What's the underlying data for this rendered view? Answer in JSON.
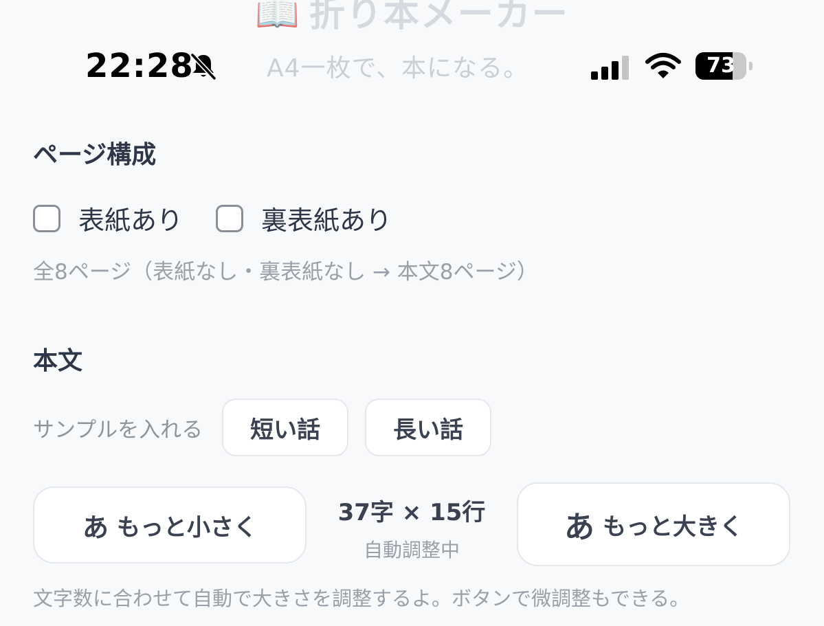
{
  "app": {
    "title_icon": "📖",
    "title": "折り本メーカー",
    "subtitle": "A4一枚で、本になる。"
  },
  "status_bar": {
    "time": "22:28",
    "mute_icon": "bell-slash-icon",
    "signal_icon": "cellular-signal-icon",
    "wifi_icon": "wifi-icon",
    "battery_level": "73",
    "battery_percent": 73
  },
  "page_structure": {
    "heading": "ページ構成",
    "front_cover": {
      "label": "表紙あり",
      "checked": false
    },
    "back_cover": {
      "label": "裏表紙あり",
      "checked": false
    },
    "summary": "全8ページ（表紙なし・裏表紙なし → 本文8ページ）"
  },
  "body_text": {
    "heading": "本文",
    "sample_label": "サンプルを入れる",
    "short_story_button": "短い話",
    "long_story_button": "長い話",
    "smaller_button": {
      "glyph": "あ",
      "label": "もっと小さく"
    },
    "larger_button": {
      "glyph": "あ",
      "label": "もっと大きく"
    },
    "grid_size": "37字 × 15行",
    "auto_status": "自動調整中",
    "note": "文字数に合わせて自動で大きさを調整するよ。ボタンで微調整もできる。"
  },
  "colors": {
    "background": "#f8f9fb",
    "text_primary": "#2d3748",
    "text_muted": "#9aa0a8",
    "border": "#e4e7ec"
  }
}
